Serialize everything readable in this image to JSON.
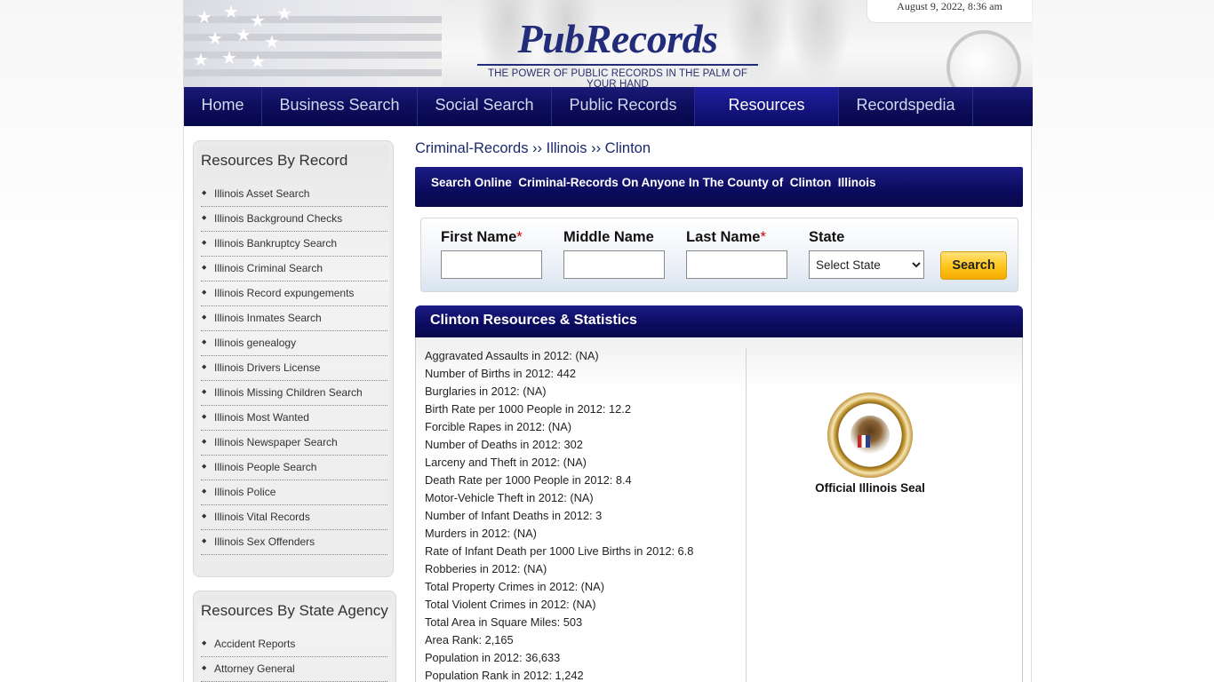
{
  "header": {
    "logo_text": "PubRecords",
    "tagline": "THE POWER OF PUBLIC RECORDS IN THE PALM OF YOUR HAND",
    "date": "August 9, 2022, 8:36 am"
  },
  "nav": {
    "items": [
      {
        "label": "Home"
      },
      {
        "label": "Business Search"
      },
      {
        "label": "Social Search"
      },
      {
        "label": "Public Records"
      },
      {
        "label": "Resources"
      },
      {
        "label": "Recordspedia"
      }
    ],
    "active": "Resources"
  },
  "sidebar": {
    "record": {
      "title": "Resources By Record",
      "items": [
        "Illinois Asset Search",
        "Illinois Background Checks",
        "Illinois Bankruptcy Search",
        "Illinois Criminal Search",
        "Illinois Record expungements",
        "Illinois Inmates Search",
        "Illinois genealogy",
        "Illinois Drivers License",
        "Illinois Missing Children Search",
        "Illinois Most Wanted",
        "Illinois Newspaper Search",
        "Illinois People Search",
        "Illinois Police",
        "Illinois Vital Records",
        "Illinois Sex Offenders"
      ]
    },
    "agency": {
      "title": "Resources By State Agency",
      "items": [
        "Accident Reports",
        "Attorney General"
      ]
    }
  },
  "breadcrumb": {
    "part1": "Criminal-Records",
    "sep1": " ›› ",
    "part2": "Illinois",
    "sep2": " ›› ",
    "part3": "Clinton"
  },
  "search_banner": "Search Online  Criminal-Records On Anyone In The County of  Clinton  Illinois",
  "search_form": {
    "first_name_label": "First Name",
    "middle_name_label": "Middle Name",
    "last_name_label": "Last Name",
    "state_label": "State",
    "required_mark": "*",
    "state_select_value": "Select State",
    "search_button": "Search"
  },
  "stats": {
    "title": "Clinton Resources & Statistics",
    "items": [
      "Aggravated Assaults in 2012: (NA)",
      "Number of Births in 2012: 442",
      "Burglaries in 2012: (NA)",
      "Birth Rate per 1000 People in 2012: 12.2",
      "Forcible Rapes in 2012: (NA)",
      "Number of Deaths in 2012: 302",
      "Larceny and Theft in 2012: (NA)",
      "Death Rate per 1000 People in 2012: 8.4",
      "Motor-Vehicle Theft in 2012: (NA)",
      "Number of Infant Deaths in 2012: 3",
      "Murders in 2012: (NA)",
      "Rate of Infant Death per 1000 Live Births in 2012: 6.8",
      "Robberies in 2012: (NA)",
      "Total Property Crimes in 2012: (NA)",
      "Total Violent Crimes in 2012: (NA)",
      "Total Area in Square Miles: 503",
      "Area Rank: 2,165",
      "Population in 2012: 36,633",
      "Population Rank in 2012: 1,242"
    ],
    "seal_caption": "Official Illinois Seal"
  }
}
